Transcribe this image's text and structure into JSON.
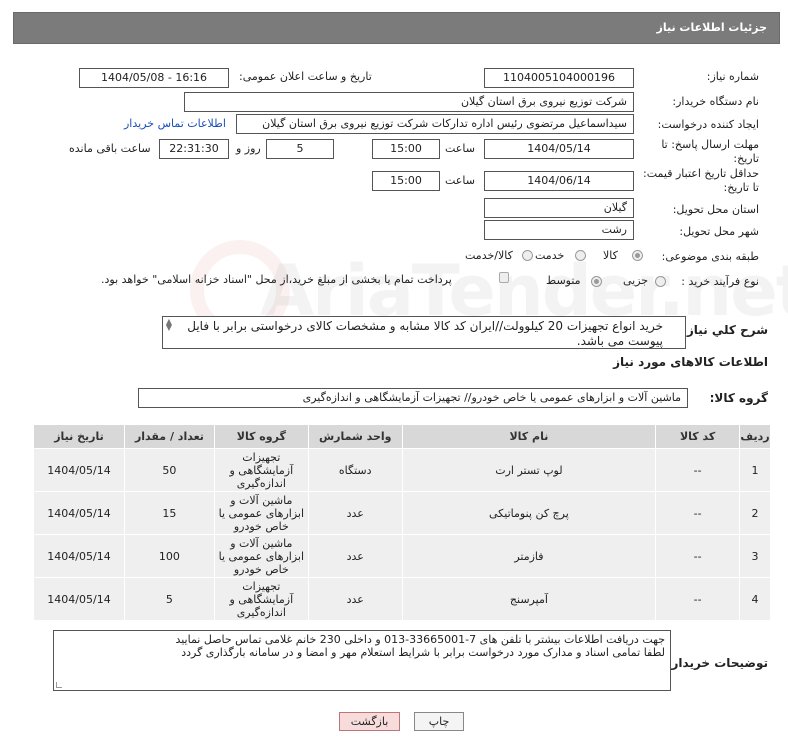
{
  "header": {
    "title": "جزئیات اطلاعات نیاز"
  },
  "fields": {
    "need_number_label": "شماره نیاز:",
    "need_number": "1104005104000196",
    "announce_label": "تاریخ و ساعت اعلان عمومی:",
    "announce_value": "1404/05/08 - 16:16",
    "buyer_org_label": "نام دستگاه خریدار:",
    "buyer_org": "شرکت توزیع نیروی برق استان گیلان",
    "creator_label": "ایجاد کننده درخواست:",
    "creator": "سیداسماعیل مرتضوی رئیس اداره تدارکات شرکت توزیع نیروی برق استان گیلان",
    "contact_link": "اطلاعات تماس خریدار",
    "reply_deadline_label_1": "مهلت ارسال پاسخ: تا",
    "reply_deadline_label_2": "تاریخ:",
    "reply_date": "1404/05/14",
    "time_label": "ساعت",
    "reply_time": "15:00",
    "days_value": "5",
    "days_label": "روز و",
    "remaining_time": "22:31:30",
    "remaining_label": "ساعت باقی مانده",
    "validity_label_1": "حداقل تاریخ اعتبار قیمت:",
    "validity_label_2": "تا تاریخ:",
    "validity_date": "1404/06/14",
    "validity_time": "15:00",
    "province_label": "استان محل تحویل:",
    "province": "گیلان",
    "city_label": "شهر محل تحویل:",
    "city": "رشت",
    "category_label": "طبقه بندی موضوعی:",
    "cat_goods": "کالا",
    "cat_service": "خدمت",
    "cat_goods_service": "کالا/خدمت",
    "process_label": "نوع فرآیند خرید :",
    "proc_partial": "جزیی",
    "proc_medium": "متوسط",
    "payment_note": "پرداخت تمام یا بخشی از مبلغ خرید،از محل \"اسناد خزانه اسلامی\" خواهد بود."
  },
  "description": {
    "label": "شرح كلي نياز:",
    "text": "خرید انواع تجهیزات 20 کیلوولت//ایران کد کالا مشابه و مشخصات کالای درخواستی برابر با فایل پیوست می باشد."
  },
  "goods": {
    "section_title": "اطلاعات کالاهای مورد نیاز",
    "group_label": "گروه کالا:",
    "group_value": "ماشین آلات و ابزارهای عمومی یا خاص خودرو// تجهیزات آزمایشگاهی و اندازه‌گیری",
    "columns": [
      "ردیف",
      "کد کالا",
      "نام کالا",
      "واحد شمارش",
      "گروه کالا",
      "تعداد / مقدار",
      "تاریخ نیاز"
    ],
    "rows": [
      [
        "1",
        "--",
        "لوپ تستر ارت",
        "دستگاه",
        "تجهیزات آزمایشگاهی و اندازه‌گیری",
        "50",
        "1404/05/14"
      ],
      [
        "2",
        "--",
        "پرچ کن پنوماتیکی",
        "عدد",
        "ماشین آلات و ابزارهای عمومی یا خاص خودرو",
        "15",
        "1404/05/14"
      ],
      [
        "3",
        "--",
        "فازمتر",
        "عدد",
        "ماشین آلات و ابزارهای عمومی یا خاص خودرو",
        "100",
        "1404/05/14"
      ],
      [
        "4",
        "--",
        "آمپرسنج",
        "عدد",
        "تجهیزات آزمایشگاهی و اندازه‌گیری",
        "5",
        "1404/05/14"
      ]
    ]
  },
  "notes": {
    "label": "توضیحات خریدار:",
    "line1": "جهت دریافت اطلاعات بیشتر با تلفن های 7-33665001-013 و داخلی 230 خانم غلامی تماس حاصل نمایید",
    "line2": "لطفا تمامی اسناد و مدارک مورد درخواست برابر با شرایط استعلام مهر و امضا و در سامانه بارگذاری گردد"
  },
  "buttons": {
    "print": "چاپ",
    "back": "بازگشت"
  },
  "colors": {
    "header_bg": "#7b7b7b",
    "link": "#1a4fb8",
    "back_button": "#f8dcdc",
    "table_header": "#d8d8d8"
  }
}
